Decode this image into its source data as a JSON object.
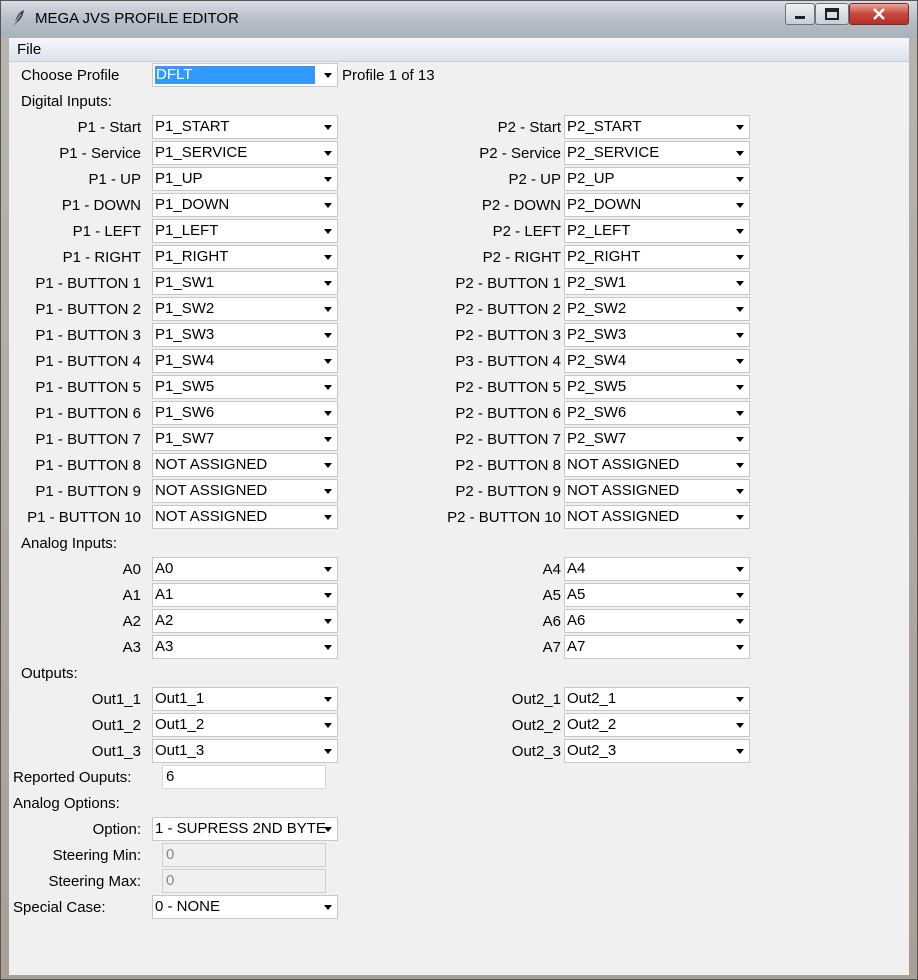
{
  "window": {
    "title": "MEGA JVS PROFILE EDITOR"
  },
  "menu": {
    "file": "File"
  },
  "profile": {
    "label": "Choose Profile",
    "value": "DFLT",
    "status": "Profile 1 of 13"
  },
  "sections": {
    "digital": "Digital Inputs:",
    "analog": "Analog Inputs:",
    "outputs": "Outputs:",
    "analog_options": "Analog Options:"
  },
  "digital_p1": [
    {
      "label": "P1 - Start",
      "value": "P1_START"
    },
    {
      "label": "P1 - Service",
      "value": "P1_SERVICE"
    },
    {
      "label": "P1 - UP",
      "value": "P1_UP"
    },
    {
      "label": "P1 - DOWN",
      "value": "P1_DOWN"
    },
    {
      "label": "P1 - LEFT",
      "value": "P1_LEFT"
    },
    {
      "label": "P1 - RIGHT",
      "value": "P1_RIGHT"
    },
    {
      "label": "P1 - BUTTON 1",
      "value": "P1_SW1"
    },
    {
      "label": "P1 - BUTTON 2",
      "value": "P1_SW2"
    },
    {
      "label": "P1 - BUTTON 3",
      "value": "P1_SW3"
    },
    {
      "label": "P1 - BUTTON 4",
      "value": "P1_SW4"
    },
    {
      "label": "P1 - BUTTON 5",
      "value": "P1_SW5"
    },
    {
      "label": "P1 - BUTTON 6",
      "value": "P1_SW6"
    },
    {
      "label": "P1 - BUTTON 7",
      "value": "P1_SW7"
    },
    {
      "label": "P1 - BUTTON 8",
      "value": "NOT ASSIGNED"
    },
    {
      "label": "P1 - BUTTON 9",
      "value": "NOT ASSIGNED"
    },
    {
      "label": "P1 - BUTTON 10",
      "value": "NOT ASSIGNED"
    }
  ],
  "digital_p2": [
    {
      "label": "P2 - Start",
      "value": "P2_START"
    },
    {
      "label": "P2 - Service",
      "value": "P2_SERVICE"
    },
    {
      "label": "P2 - UP",
      "value": "P2_UP"
    },
    {
      "label": "P2 - DOWN",
      "value": "P2_DOWN"
    },
    {
      "label": "P2 - LEFT",
      "value": "P2_LEFT"
    },
    {
      "label": "P2 - RIGHT",
      "value": "P2_RIGHT"
    },
    {
      "label": "P2 - BUTTON 1",
      "value": "P2_SW1"
    },
    {
      "label": "P2 - BUTTON 2",
      "value": "P2_SW2"
    },
    {
      "label": "P2 - BUTTON 3",
      "value": "P2_SW3"
    },
    {
      "label": "P3 - BUTTON 4",
      "value": "P2_SW4"
    },
    {
      "label": "P2 - BUTTON 5",
      "value": "P2_SW5"
    },
    {
      "label": "P2 - BUTTON 6",
      "value": "P2_SW6"
    },
    {
      "label": "P2 - BUTTON 7",
      "value": "P2_SW7"
    },
    {
      "label": "P2 - BUTTON 8",
      "value": "NOT ASSIGNED"
    },
    {
      "label": "P2 - BUTTON 9",
      "value": "NOT ASSIGNED"
    },
    {
      "label": "P2 - BUTTON 10",
      "value": "NOT ASSIGNED"
    }
  ],
  "analog_left": [
    {
      "label": "A0",
      "value": "A0"
    },
    {
      "label": "A1",
      "value": "A1"
    },
    {
      "label": "A2",
      "value": "A2"
    },
    {
      "label": "A3",
      "value": "A3"
    }
  ],
  "analog_right": [
    {
      "label": "A4",
      "value": "A4"
    },
    {
      "label": "A5",
      "value": "A5"
    },
    {
      "label": "A6",
      "value": "A6"
    },
    {
      "label": "A7",
      "value": "A7"
    }
  ],
  "outputs_left": [
    {
      "label": "Out1_1",
      "value": "Out1_1"
    },
    {
      "label": "Out1_2",
      "value": "Out1_2"
    },
    {
      "label": "Out1_3",
      "value": "Out1_3"
    }
  ],
  "outputs_right": [
    {
      "label": "Out2_1",
      "value": "Out2_1"
    },
    {
      "label": "Out2_2",
      "value": "Out2_2"
    },
    {
      "label": "Out2_3",
      "value": "Out2_3"
    }
  ],
  "reported_outputs": {
    "label": "Reported Ouputs:",
    "value": "6"
  },
  "analog_option": {
    "label": "Option:",
    "value": "1 - SUPRESS 2ND BYTE"
  },
  "steering_min": {
    "label": "Steering Min:",
    "value": "0"
  },
  "steering_max": {
    "label": "Steering Max:",
    "value": "0"
  },
  "special_case": {
    "label": "Special Case:",
    "value": "0 - NONE"
  }
}
